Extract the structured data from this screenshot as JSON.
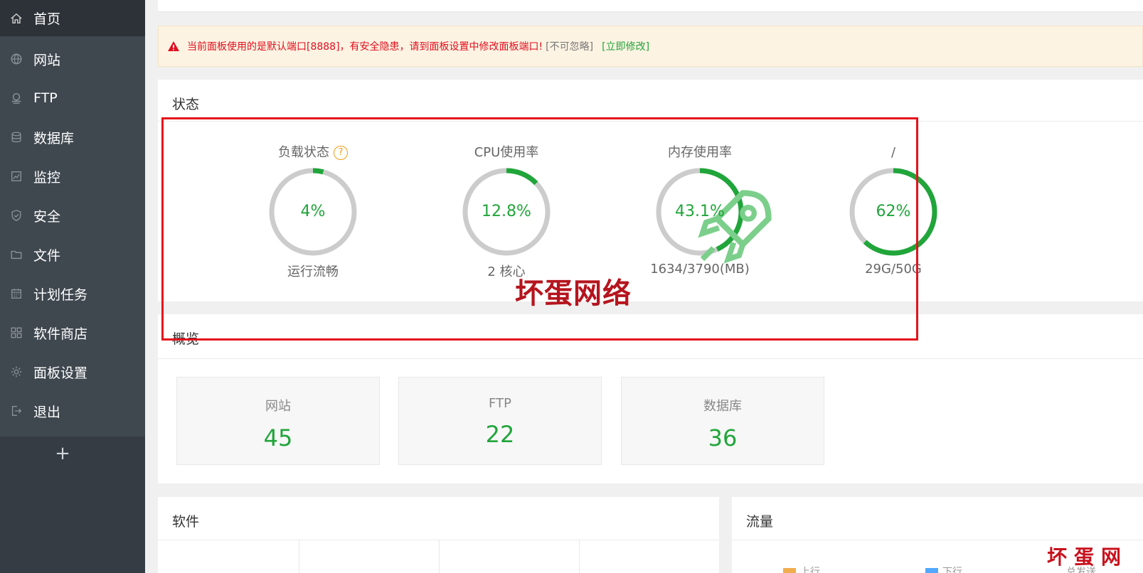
{
  "sidebar": {
    "items": [
      {
        "label": "首页",
        "icon": "home-icon",
        "active": true
      },
      {
        "label": "网站",
        "icon": "globe-icon"
      },
      {
        "label": "FTP",
        "icon": "ftp-icon"
      },
      {
        "label": "数据库",
        "icon": "database-icon"
      },
      {
        "label": "监控",
        "icon": "monitor-icon"
      },
      {
        "label": "安全",
        "icon": "shield-icon"
      },
      {
        "label": "文件",
        "icon": "folder-icon"
      },
      {
        "label": "计划任务",
        "icon": "calendar-icon"
      },
      {
        "label": "软件商店",
        "icon": "grid-icon"
      },
      {
        "label": "面板设置",
        "icon": "gear-icon"
      },
      {
        "label": "退出",
        "icon": "logout-icon"
      }
    ],
    "add_label": "+"
  },
  "alert": {
    "message": "当前面板使用的是默认端口[8888]，有安全隐患，请到面板设置中修改面板端口!",
    "ignore_label": "[不可忽略]",
    "fix_label": "[立即修改]"
  },
  "status": {
    "title": "状态",
    "gauges": [
      {
        "title": "负载状态",
        "value": "4%",
        "percent": 4,
        "sub": "运行流畅",
        "help": "?"
      },
      {
        "title": "CPU使用率",
        "value": "12.8%",
        "percent": 12.8,
        "sub": "2 核心"
      },
      {
        "title": "内存使用率",
        "value": "43.1%",
        "percent": 43.1,
        "sub": "1634/3790(MB)"
      },
      {
        "title": "/",
        "value": "62%",
        "percent": 62,
        "sub": "29G/50G"
      }
    ]
  },
  "overview": {
    "title": "概览",
    "cards": [
      {
        "label": "网站",
        "value": "45"
      },
      {
        "label": "FTP",
        "value": "22"
      },
      {
        "label": "数据库",
        "value": "36"
      }
    ]
  },
  "software": {
    "title": "软件"
  },
  "traffic": {
    "title": "流量",
    "legend": [
      {
        "label": "上行",
        "color": "#f0ad4e"
      },
      {
        "label": "下行",
        "color": "#52a9ff"
      },
      {
        "label": "总发送"
      }
    ]
  },
  "colors": {
    "accent": "#20a53a",
    "ring_track": "#cccccc",
    "danger": "#e0101e",
    "sidebar": "#3f474f"
  },
  "watermark": {
    "center": "坏蛋网络",
    "corner": "坏蛋网络"
  }
}
